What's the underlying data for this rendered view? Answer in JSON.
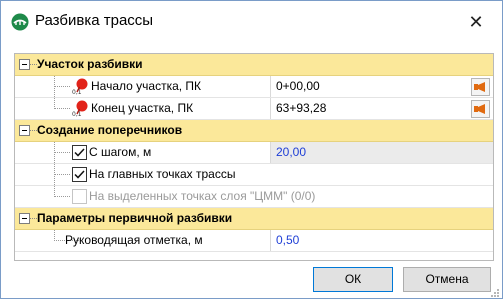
{
  "window": {
    "title": "Разбивка трассы",
    "close_symbol": "✕",
    "app_icon": "road-route-icon"
  },
  "sections": [
    {
      "label": "Участок разбивки",
      "props": [
        {
          "name": "Начало участка, ПК",
          "value": "0+00,00",
          "icon": "red-pin-icon"
        },
        {
          "name": "Конец участка, ПК",
          "value": "63+93,28",
          "icon": "red-pin-icon"
        }
      ]
    },
    {
      "label": "Создание поперечников",
      "props": [
        {
          "name": "С шагом, м",
          "value": "20,00",
          "checked": true
        },
        {
          "name": "На главных точках трассы",
          "checked": true
        },
        {
          "name": "На выделенных точках слоя \"ЦММ\" (0/0)",
          "checked": false
        }
      ]
    },
    {
      "label": "Параметры первичной разбивки",
      "props": [
        {
          "name": "Руководящая отметка, м",
          "value": "0,50"
        }
      ]
    }
  ],
  "buttons": {
    "ok": "ОК",
    "cancel": "Отмена"
  },
  "colors": {
    "category_bg": "#fbe89a",
    "value_blue": "#1f3fd6",
    "pin_red": "#e2231a",
    "icon_green": "#1e8a4a"
  }
}
